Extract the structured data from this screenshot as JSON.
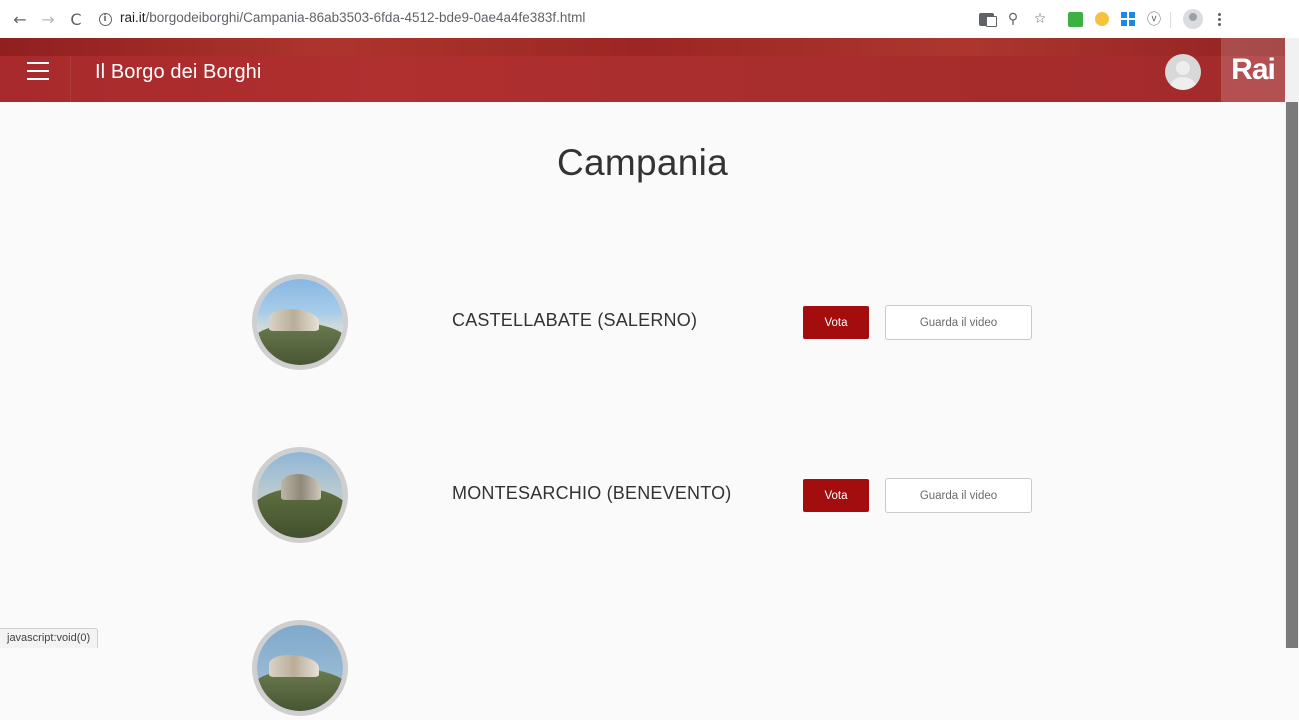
{
  "browser": {
    "url_host": "rai.it",
    "url_path": "/borgodeiborghi/Campania-86ab3503-6fda-4512-bde9-0ae4a4fe383f.html",
    "back_icon": "←",
    "forward_icon": "→",
    "reload_icon": "C",
    "info_icon": "i",
    "zoom_icon": "⚲",
    "star_icon": "☆",
    "v_icon": "ⓥ"
  },
  "header": {
    "site_title": "Il Borgo dei Borghi",
    "logo_text": "Rai",
    "colors": {
      "header_bg": "#a82a2c",
      "vota_bg": "#a30d0d"
    }
  },
  "main": {
    "page_title": "Campania",
    "borghi": [
      {
        "name": "CASTELLABATE (SALERNO)",
        "vote_label": "Vota",
        "video_label": "Guarda il video"
      },
      {
        "name": "MONTESARCHIO (BENEVENTO)",
        "vote_label": "Vota",
        "video_label": "Guarda il video"
      }
    ]
  },
  "status_bar": {
    "text": "javascript:void(0)"
  }
}
